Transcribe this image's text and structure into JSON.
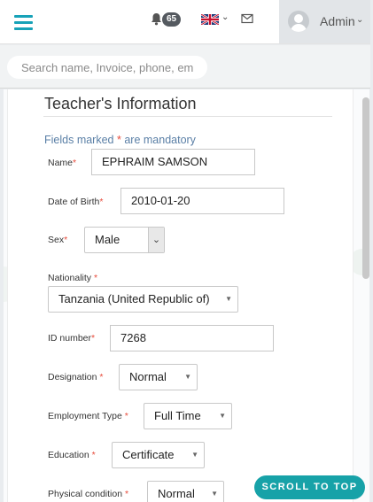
{
  "header": {
    "notification_count": "65",
    "user_name": "Admin",
    "icons": {
      "menu": "hamburger-icon",
      "bell": "bell-icon",
      "flag": "uk-flag-icon",
      "mail": "mail-icon",
      "avatar": "user-avatar-icon"
    },
    "accent_color": "#17a2b8"
  },
  "search": {
    "placeholder": "Search name, Invoice, phone, ema",
    "value": ""
  },
  "form": {
    "title": "Teacher's Information",
    "mandatory_prefix": "Fields marked ",
    "mandatory_star": "*",
    "mandatory_suffix": " are mandatory",
    "fields": {
      "name": {
        "label": "Name",
        "value": "EPHRAIM SAMSON"
      },
      "dob": {
        "label": "Date of Birth",
        "value": "2010-01-20"
      },
      "sex": {
        "label": "Sex",
        "value": "Male"
      },
      "nationality": {
        "label": "Nationality ",
        "value": "Tanzania (United Republic of)"
      },
      "id_number": {
        "label": "ID number",
        "value": "7268"
      },
      "designation": {
        "label": "Designation ",
        "value": "Normal"
      },
      "employment_type": {
        "label": "Employment Type ",
        "value": "Full Time"
      },
      "education": {
        "label": "Education ",
        "value": "Certificate"
      },
      "physical_condition": {
        "label": "Physical condition ",
        "value": "Normal"
      }
    },
    "required_marker": "*"
  },
  "scroll_top_label": "SCROLL TO TOP"
}
